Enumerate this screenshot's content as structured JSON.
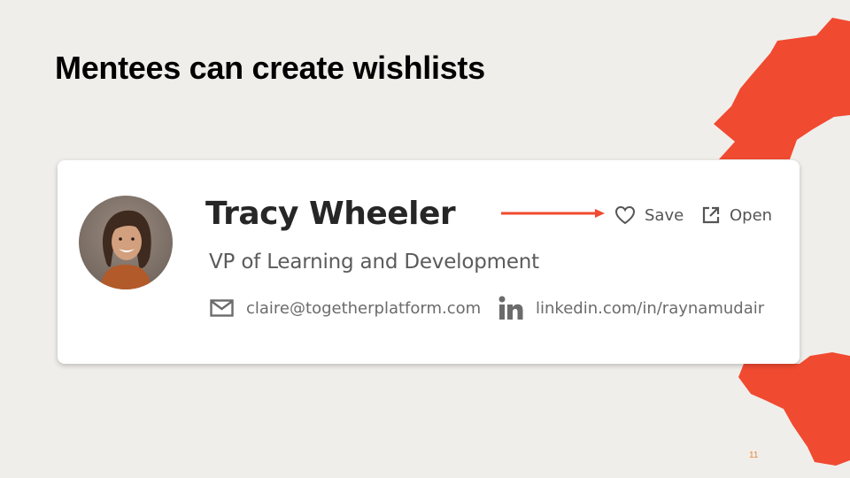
{
  "slide": {
    "title": "Mentees can create wishlists",
    "page_number": "11"
  },
  "profile_card": {
    "name": "Tracy Wheeler",
    "role": "VP of Learning and Development",
    "email": "claire@togetherplatform.com",
    "linkedin": "linkedin.com/in/raynamudair",
    "save_label": "Save",
    "open_label": "Open"
  },
  "icons": {
    "email": "mail-icon",
    "linkedin": "linkedin-icon",
    "save": "heart-icon",
    "open": "external-link-icon"
  },
  "colors": {
    "accent": "#f04a31",
    "page_number": "#e8863a",
    "background": "#f0eeea",
    "card": "#ffffff"
  }
}
